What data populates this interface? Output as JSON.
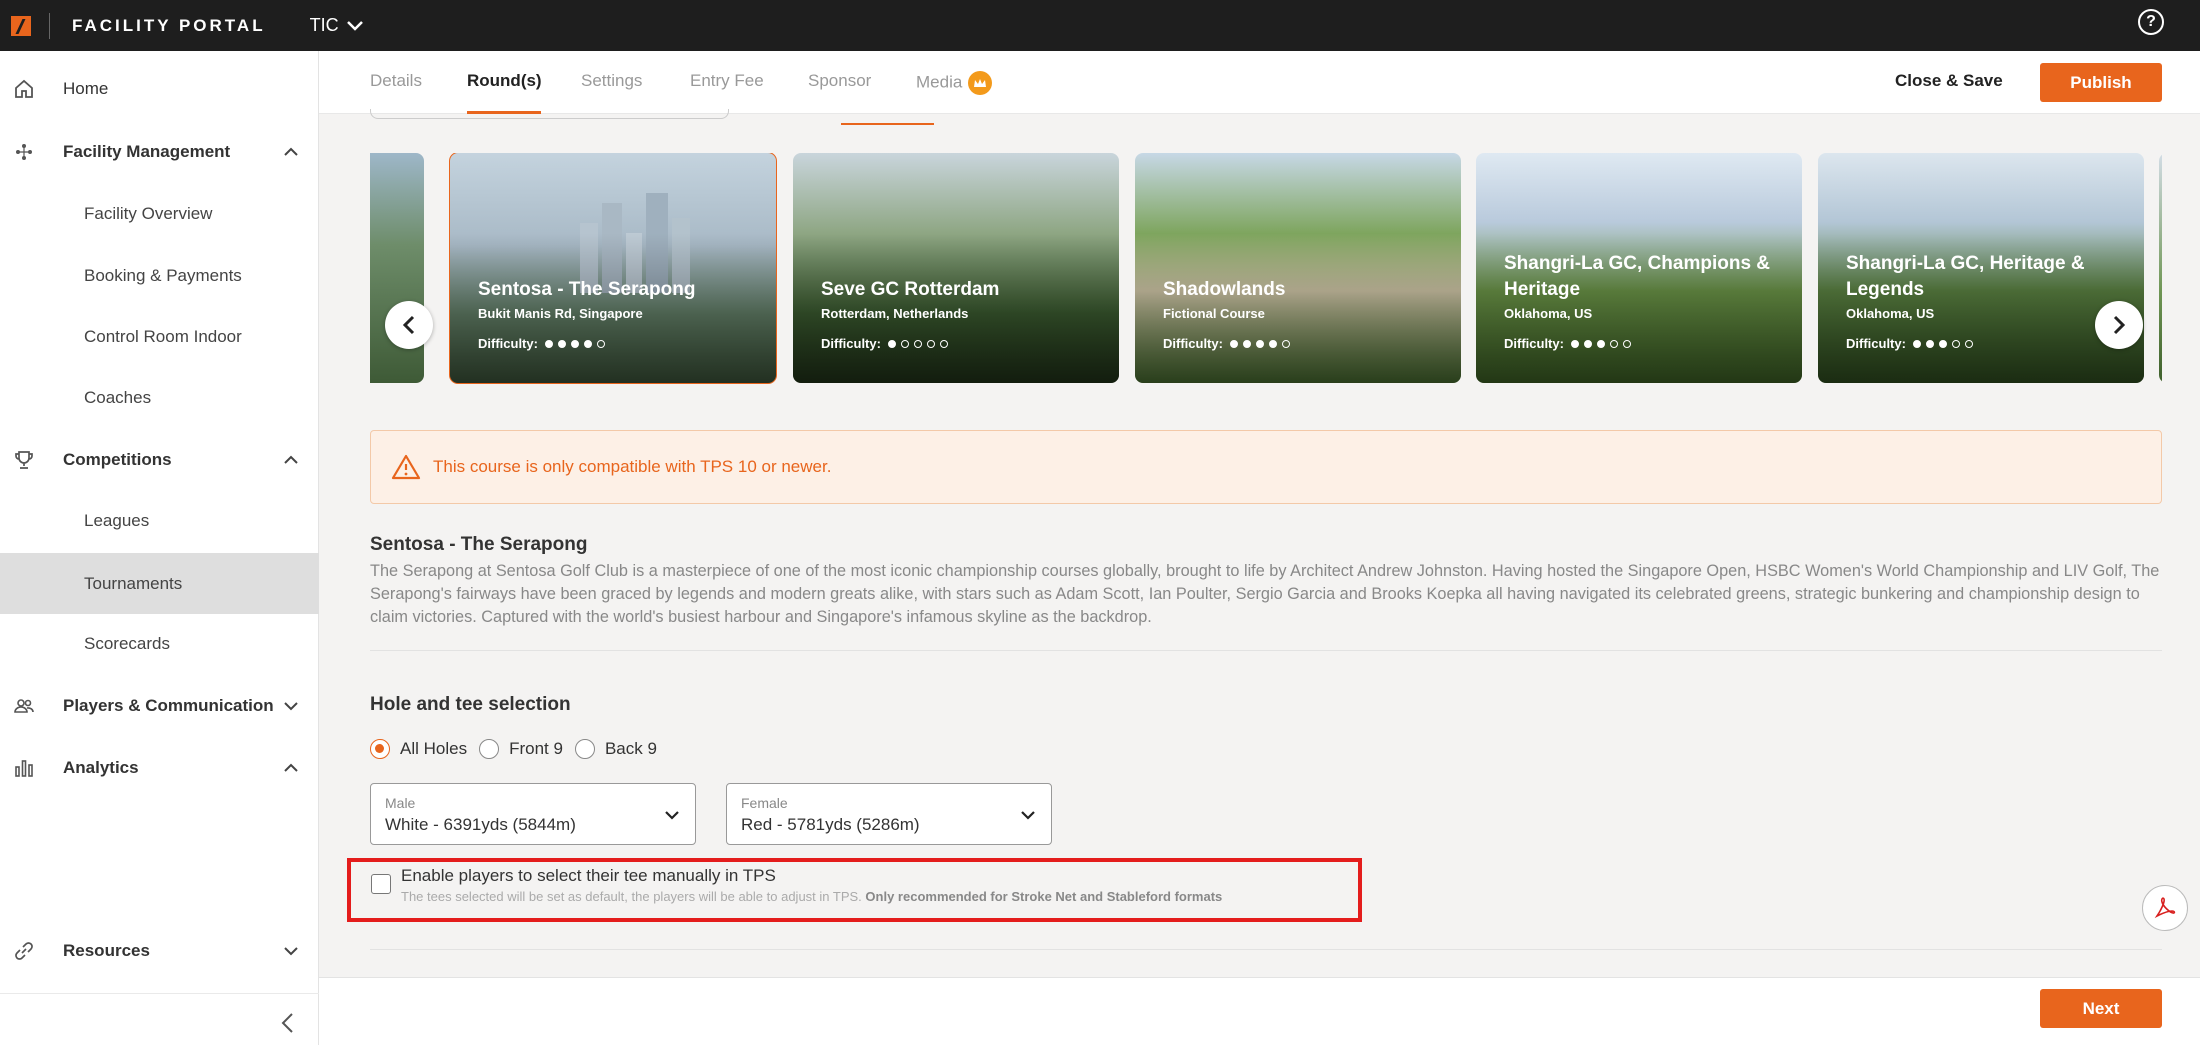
{
  "topbar": {
    "brand": "FACILITY PORTAL",
    "facility": "TIC",
    "help_label": "?"
  },
  "sidebar": {
    "home": "Home",
    "facility_management": "Facility Management",
    "facility_items": [
      "Facility Overview",
      "Booking & Payments",
      "Control Room Indoor",
      "Coaches"
    ],
    "competitions": "Competitions",
    "competition_items": [
      "Leagues",
      "Tournaments",
      "Scorecards"
    ],
    "active_item": "Tournaments",
    "players": "Players & Communication",
    "analytics": "Analytics",
    "resources": "Resources"
  },
  "tabs": {
    "details": "Details",
    "rounds": "Round(s)",
    "settings": "Settings",
    "entry_fee": "Entry Fee",
    "sponsor": "Sponsor",
    "media": "Media",
    "active": "Round(s)"
  },
  "actions": {
    "close_save": "Close & Save",
    "publish": "Publish",
    "next": "Next"
  },
  "courses": [
    {
      "name": "",
      "location": "",
      "difficulty": 0
    },
    {
      "name": "Sentosa - The Serapong",
      "location": "Bukit Manis Rd, Singapore",
      "difficulty_label": "Difficulty:",
      "difficulty": 4,
      "selected": true
    },
    {
      "name": "Seve GC Rotterdam",
      "location": "Rotterdam, Netherlands",
      "difficulty_label": "Difficulty:",
      "difficulty": 1
    },
    {
      "name": "Shadowlands",
      "location": "Fictional Course",
      "difficulty_label": "Difficulty:",
      "difficulty": 4
    },
    {
      "name": "Shangri-La GC, Champions & Heritage",
      "location": "Oklahoma, US",
      "difficulty_label": "Difficulty:",
      "difficulty": 3
    },
    {
      "name": "Shangri-La GC, Heritage & Legends",
      "location": "Oklahoma, US",
      "difficulty_label": "Difficulty:",
      "difficulty": 3
    }
  ],
  "warning": "This course is only compatible with TPS 10 or newer.",
  "course_detail": {
    "title": "Sentosa - The Serapong",
    "description": "The Serapong at Sentosa Golf Club is a masterpiece of one of the most iconic championship courses globally, brought to life by Architect Andrew Johnston. Having hosted the Singapore Open, HSBC Women's World Championship and LIV Golf, The Serapong's fairways have been graced by legends and modern greats alike, with stars such as Adam Scott, Ian Poulter, Sergio Garcia and Brooks Koepka all having navigated its celebrated greens, strategic bunkering and championship design to claim victories. Captured with the world's busiest harbour and Singapore's infamous skyline as the backdrop."
  },
  "hole_tee": {
    "title": "Hole and tee selection",
    "options": [
      "All Holes",
      "Front 9",
      "Back 9"
    ],
    "selected": "All Holes",
    "male_label": "Male",
    "male_value": "White - 6391yds (5844m)",
    "female_label": "Female",
    "female_value": "Red - 5781yds (5286m)",
    "manual_tee_label": "Enable players to select their tee manually in TPS",
    "manual_tee_hint": "The tees selected will be set as default, the players will be able to adjust in TPS.",
    "manual_tee_hint_bold": "Only recommended for Stroke Net and Stableford formats",
    "manual_tee_checked": false
  },
  "colors": {
    "accent": "#e8651d",
    "topbar": "#1e1e1e",
    "highlight": "#e41c1c"
  }
}
